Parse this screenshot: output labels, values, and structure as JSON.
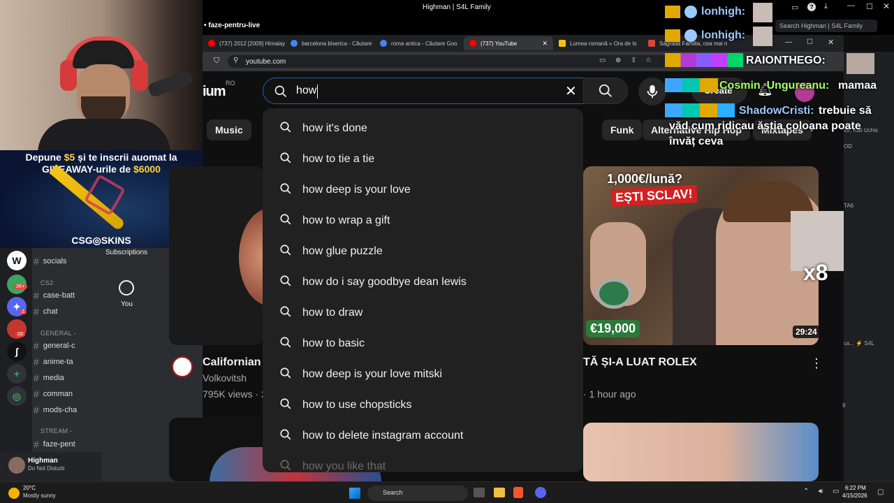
{
  "window": {
    "title": "Highman | S4L Family",
    "search_placeholder": "Search Highman | S4L Family",
    "channel_header": "faze-pentru-live"
  },
  "tabs": [
    {
      "label": "(737) 2012 [2009] Himalay",
      "color": "#ff0000"
    },
    {
      "label": "barcelona biserica - Căutare",
      "color": "#4285f4"
    },
    {
      "label": "roma antica - Căutare Goo",
      "color": "#4285f4"
    },
    {
      "label": "(737) YouTube",
      "color": "#ff0000",
      "active": true
    },
    {
      "label": "Lumea romană » Ora de Is",
      "color": "#f4c20d"
    },
    {
      "label": "Sagrada Familia, cea mai n",
      "color": "#db4437"
    }
  ],
  "address": {
    "url": "youtube.com"
  },
  "youtube": {
    "logo_suffix": "ium",
    "region": "RO",
    "search_value": "how",
    "create_label": "Create",
    "chips": [
      "Music",
      "Funk",
      "Alternative Hip Hop",
      "Mixtapes"
    ],
    "suggestions": [
      "how it's done",
      "how to tie a tie",
      "how deep is your love",
      "how to wrap a gift",
      "how glue puzzle",
      "how do i say goodbye dean lewis",
      "how to draw",
      "how to basic",
      "how deep is your love mitski",
      "how to use chopsticks",
      "how to delete instagram account",
      "how you like that"
    ],
    "nav": {
      "subscriptions": "Subscriptions",
      "you": "You"
    },
    "videos": [
      {
        "title": "Californian s",
        "channel": "Volkovitsh",
        "meta": "795K views · 2"
      },
      {
        "title": "TĂ ȘI-A LUAT ROLEX",
        "meta": "· 1 hour ago",
        "duration": "29:24",
        "thumb_top": "1,000€/lună?",
        "thumb_mid": "EȘTI SCLAV!",
        "thumb_price": "€19,000"
      }
    ],
    "side_overlay": "x8"
  },
  "discord": {
    "categories": [
      "CS2",
      "GENERAL -",
      "STREAM -"
    ],
    "channels": [
      "socials",
      "case-batt",
      "chat",
      "general-c",
      "anime-ta",
      "media",
      "comman",
      "mods-cha",
      "faze-pent"
    ],
    "user": {
      "name": "Highman",
      "status": "Do Not Disturb"
    },
    "badges": [
      "2K+",
      "2",
      "10"
    ]
  },
  "promo": {
    "line1a": "Depune ",
    "amount": "$5",
    "line1b": " și te inscrii auomat la",
    "line2a": "GIVEAWAY-urile de ",
    "prize": "$6000",
    "brand": "CSG◎SKINS"
  },
  "chat": [
    {
      "user": "lonhigh:",
      "text": "",
      "color": "#9cc9ff"
    },
    {
      "user": "lonhigh:",
      "text": "",
      "color": "#9cc9ff"
    },
    {
      "user": "RAIONTHEGO:",
      "text": "",
      "color": "#ffffff"
    },
    {
      "user": "Cosmin_Ungureanu:",
      "text": "mamaa",
      "color": "#a6ff6b"
    },
    {
      "user": "ShadowCristi:",
      "text": "trebuie să",
      "color": "#9cc9ff"
    },
    {
      "user": "",
      "text": "văd cum ridicau ăștia coloana poate",
      "color": "#ffffff"
    },
    {
      "user": "",
      "text": "învăț ceva",
      "color": "#ffffff"
    }
  ],
  "right_fragments": [
    "tor, Kali Uchis",
    "OD",
    "TA6",
    "us... ⚡ S4L",
    "9"
  ],
  "taskbar": {
    "weather_temp": "20°C",
    "weather_desc": "Mostly sunny",
    "search_label": "Search",
    "time": "6:22 PM",
    "date": "4/15/2026"
  }
}
